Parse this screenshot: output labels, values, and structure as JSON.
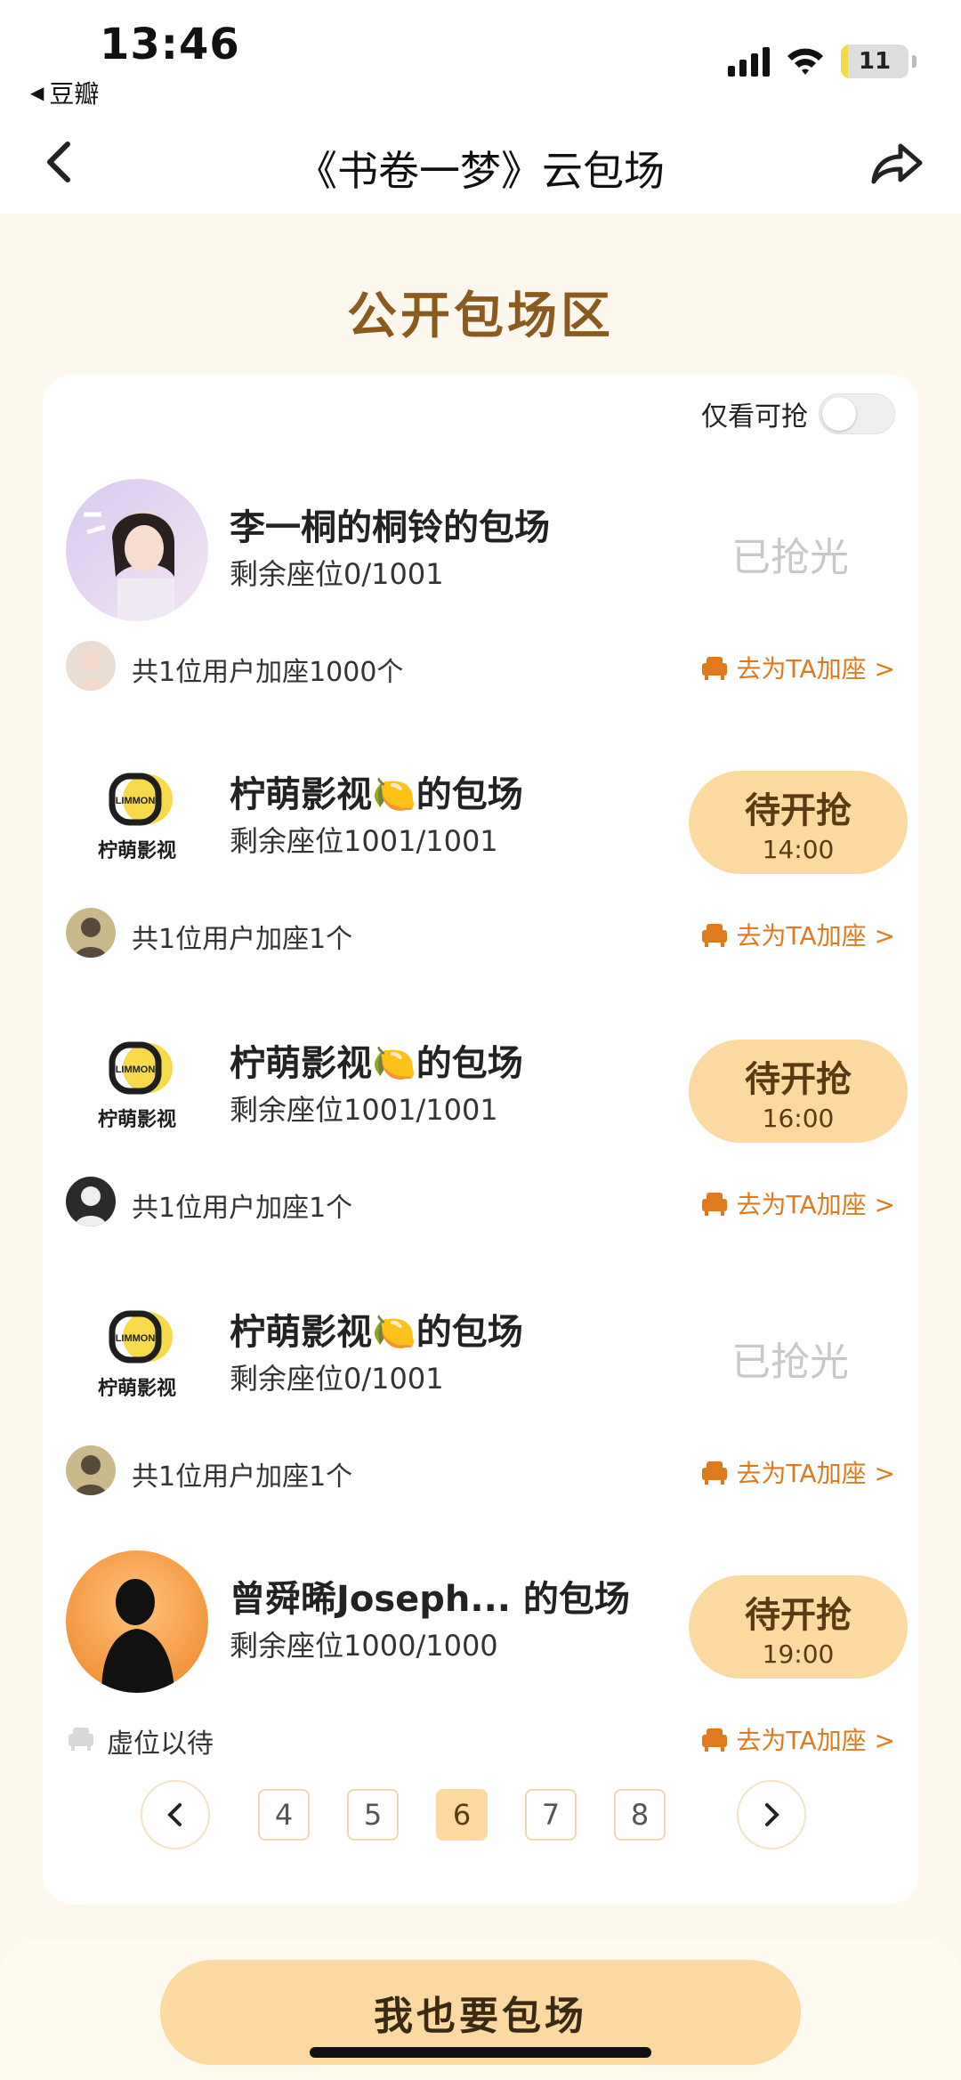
{
  "status_bar": {
    "time": "13:46",
    "back_app": "豆瓣",
    "battery": "11",
    "battery_level": 0.11
  },
  "nav": {
    "title": "《书卷一梦》云包场"
  },
  "section_title": "公开包场区",
  "filter": {
    "toggle_label": "仅看可抢",
    "toggle_on": false
  },
  "entries": [
    {
      "name": "李一桐的桐铃的包场",
      "seats": "剩余座位0/1001",
      "status_type": "sold",
      "status_label": "已抢光",
      "status_time": "",
      "sub_text": "共1位用户加座1000个",
      "add_link": "去为TA加座 >"
    },
    {
      "name": "柠萌影视🍋的包场",
      "seats": "剩余座位1001/1001",
      "status_type": "pending",
      "status_label": "待开抢",
      "status_time": "14:00",
      "sub_text": "共1位用户加座1个",
      "add_link": "去为TA加座 >"
    },
    {
      "name": "柠萌影视🍋的包场",
      "seats": "剩余座位1001/1001",
      "status_type": "pending",
      "status_label": "待开抢",
      "status_time": "16:00",
      "sub_text": "共1位用户加座1个",
      "add_link": "去为TA加座 >"
    },
    {
      "name": "柠萌影视🍋的包场",
      "seats": "剩余座位0/1001",
      "status_type": "sold",
      "status_label": "已抢光",
      "status_time": "",
      "sub_text": "共1位用户加座1个",
      "add_link": "去为TA加座 >"
    },
    {
      "name": "曾舜晞Joseph...   的包场",
      "seats": "剩余座位1000/1000",
      "status_type": "pending",
      "status_label": "待开抢",
      "status_time": "19:00",
      "sub_text": "虚位以待",
      "add_link": "去为TA加座 >"
    }
  ],
  "logo": {
    "badge": "LIMMON",
    "name": "柠萌影视"
  },
  "pagination": {
    "pages": [
      "4",
      "5",
      "6",
      "7",
      "8"
    ],
    "active": "6"
  },
  "cta": "我也要包场",
  "colors": {
    "accent": "#fcd9a0",
    "link": "#e07a1f",
    "title": "#8a5a1e",
    "sold": "#c8c8c8"
  }
}
